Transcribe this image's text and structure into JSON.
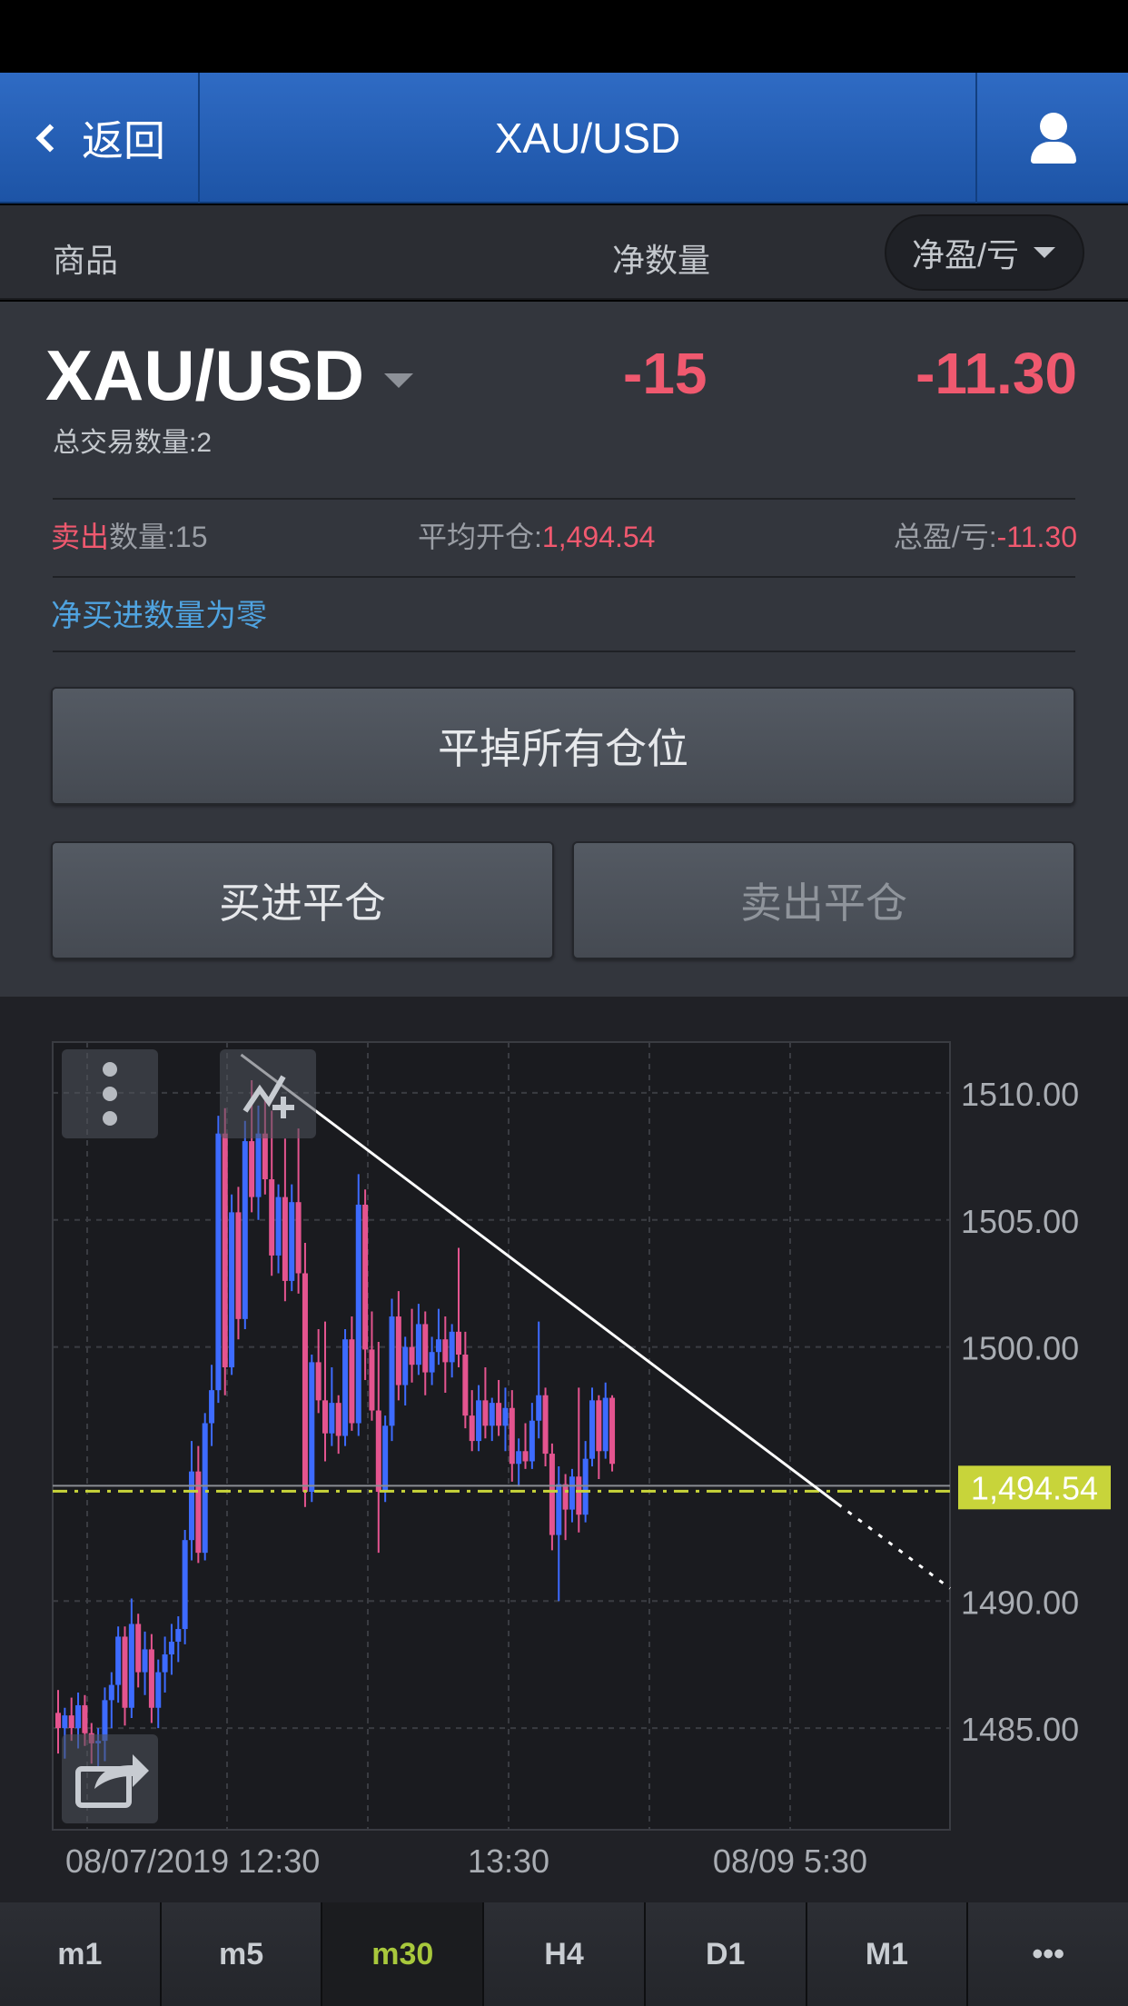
{
  "navbar": {
    "back_label": "返回",
    "title": "XAU/USD"
  },
  "columns": {
    "product": "商品",
    "net_qty": "净数量",
    "pnl_select": "净盈/亏"
  },
  "position": {
    "symbol": "XAU/USD",
    "total_trades": "总交易数量:2",
    "net_qty": "-15",
    "net_pnl": "-11.30",
    "side": "卖出",
    "qty": "数量:15",
    "avg_open_label": "平均开仓:",
    "avg_open_value": "1,494.54",
    "total_pnl_label": "总盈/亏:",
    "total_pnl_value": "-11.30",
    "zero_note": "净买进数量为零"
  },
  "buttons": {
    "close_all": "平掉所有仓位",
    "buy_close": "买进平仓",
    "sell_close": "卖出平仓"
  },
  "chart_data": {
    "type": "candlestick",
    "symbol": "XAU/USD",
    "ylim": [
      1481,
      1512
    ],
    "y_ticks": [
      "1510.00",
      "1505.00",
      "1500.00",
      "1490.00",
      "1485.00"
    ],
    "x_ticks": [
      "08/07/2019 12:30",
      "13:30",
      "08/09 5:30"
    ],
    "current_price_label": "1,494.54",
    "current_price": 1494.54,
    "colors": {
      "up": "#3d6bff",
      "down": "#e4548f",
      "price_line": "#c8d43a",
      "trendline": "#ffffff"
    },
    "trendline": {
      "start": [
        0.21,
        1511.5
      ],
      "end": [
        1.0,
        1490.5
      ]
    },
    "candles": [
      [
        1485.6,
        1486.5,
        1484.0,
        1485.0
      ],
      [
        1485.0,
        1485.8,
        1483.8,
        1485.5
      ],
      [
        1485.5,
        1486.2,
        1484.5,
        1485.0
      ],
      [
        1485.0,
        1486.4,
        1484.2,
        1485.9
      ],
      [
        1485.9,
        1486.3,
        1484.3,
        1484.8
      ],
      [
        1484.8,
        1485.2,
        1483.6,
        1484.4
      ],
      [
        1484.4,
        1485.0,
        1483.5,
        1484.5
      ],
      [
        1484.5,
        1486.6,
        1483.7,
        1486.1
      ],
      [
        1486.1,
        1487.2,
        1485.0,
        1486.7
      ],
      [
        1486.7,
        1489.0,
        1486.0,
        1488.6
      ],
      [
        1488.6,
        1489.0,
        1485.1,
        1485.8
      ],
      [
        1485.8,
        1490.1,
        1485.4,
        1489.1
      ],
      [
        1489.1,
        1489.5,
        1486.6,
        1487.2
      ],
      [
        1487.2,
        1488.8,
        1486.3,
        1488.1
      ],
      [
        1488.1,
        1488.7,
        1485.2,
        1485.8
      ],
      [
        1485.8,
        1487.7,
        1485.0,
        1487.2
      ],
      [
        1487.2,
        1488.6,
        1486.4,
        1487.9
      ],
      [
        1487.9,
        1489.1,
        1487.1,
        1488.4
      ],
      [
        1488.4,
        1489.4,
        1487.6,
        1488.9
      ],
      [
        1488.9,
        1492.8,
        1488.3,
        1492.4
      ],
      [
        1492.4,
        1496.3,
        1491.6,
        1495.1
      ],
      [
        1495.1,
        1496.1,
        1491.5,
        1491.9
      ],
      [
        1491.9,
        1497.4,
        1491.6,
        1497.0
      ],
      [
        1497.0,
        1499.3,
        1496.1,
        1498.3
      ],
      [
        1498.3,
        1509.1,
        1497.8,
        1508.4
      ],
      [
        1508.4,
        1509.4,
        1498.1,
        1499.2
      ],
      [
        1499.2,
        1506.0,
        1498.9,
        1505.3
      ],
      [
        1505.3,
        1506.3,
        1500.3,
        1501.1
      ],
      [
        1501.1,
        1508.9,
        1500.7,
        1508.1
      ],
      [
        1508.1,
        1510.5,
        1505.3,
        1505.9
      ],
      [
        1505.9,
        1509.5,
        1505.0,
        1508.4
      ],
      [
        1508.4,
        1510.0,
        1506.0,
        1506.6
      ],
      [
        1506.6,
        1509.3,
        1502.8,
        1503.6
      ],
      [
        1503.6,
        1506.4,
        1502.9,
        1505.9
      ],
      [
        1505.9,
        1508.2,
        1501.8,
        1502.6
      ],
      [
        1502.6,
        1506.4,
        1502.2,
        1505.7
      ],
      [
        1505.7,
        1508.6,
        1502.1,
        1502.9
      ],
      [
        1502.9,
        1504.1,
        1493.7,
        1494.3
      ],
      [
        1494.3,
        1499.7,
        1493.9,
        1499.4
      ],
      [
        1499.4,
        1500.7,
        1497.4,
        1497.9
      ],
      [
        1497.9,
        1501.0,
        1495.5,
        1496.6
      ],
      [
        1496.6,
        1499.2,
        1496.1,
        1497.8
      ],
      [
        1497.8,
        1498.1,
        1495.8,
        1496.5
      ],
      [
        1496.5,
        1500.7,
        1496.1,
        1500.3
      ],
      [
        1500.3,
        1501.2,
        1496.7,
        1497.0
      ],
      [
        1497.0,
        1506.8,
        1496.5,
        1505.6
      ],
      [
        1505.6,
        1506.2,
        1498.7,
        1499.9
      ],
      [
        1499.9,
        1501.4,
        1497.1,
        1497.5
      ],
      [
        1497.5,
        1500.2,
        1491.9,
        1494.3
      ],
      [
        1494.3,
        1497.3,
        1493.9,
        1496.9
      ],
      [
        1496.9,
        1501.9,
        1496.3,
        1501.2
      ],
      [
        1501.2,
        1502.2,
        1497.9,
        1498.5
      ],
      [
        1498.5,
        1500.4,
        1497.7,
        1500.0
      ],
      [
        1500.0,
        1501.5,
        1498.6,
        1499.3
      ],
      [
        1499.3,
        1501.7,
        1498.9,
        1500.9
      ],
      [
        1500.9,
        1501.4,
        1498.1,
        1499.0
      ],
      [
        1499.0,
        1500.4,
        1498.5,
        1499.8
      ],
      [
        1499.8,
        1501.5,
        1499.3,
        1500.3
      ],
      [
        1500.3,
        1501.2,
        1498.2,
        1499.4
      ],
      [
        1499.4,
        1500.9,
        1498.8,
        1500.6
      ],
      [
        1500.6,
        1503.9,
        1499.2,
        1499.7
      ],
      [
        1499.7,
        1500.6,
        1496.8,
        1497.3
      ],
      [
        1497.3,
        1498.3,
        1495.9,
        1496.3
      ],
      [
        1496.3,
        1498.5,
        1495.9,
        1497.9
      ],
      [
        1497.9,
        1499.2,
        1496.4,
        1496.9
      ],
      [
        1496.9,
        1498.0,
        1496.3,
        1497.8
      ],
      [
        1497.8,
        1498.7,
        1496.5,
        1496.9
      ],
      [
        1496.9,
        1498.4,
        1495.9,
        1497.6
      ],
      [
        1497.6,
        1498.3,
        1494.7,
        1495.4
      ],
      [
        1495.4,
        1496.4,
        1494.5,
        1495.9
      ],
      [
        1495.9,
        1497.0,
        1495.2,
        1495.5
      ],
      [
        1495.5,
        1497.8,
        1495.2,
        1497.1
      ],
      [
        1497.1,
        1501.0,
        1496.4,
        1498.1
      ],
      [
        1498.1,
        1498.4,
        1495.3,
        1495.8
      ],
      [
        1495.8,
        1496.2,
        1492.0,
        1492.6
      ],
      [
        1492.6,
        1495.3,
        1490.0,
        1494.6
      ],
      [
        1494.6,
        1495.0,
        1492.4,
        1493.6
      ],
      [
        1493.6,
        1495.2,
        1493.1,
        1494.9
      ],
      [
        1494.9,
        1498.4,
        1492.7,
        1493.4
      ],
      [
        1493.4,
        1496.3,
        1493.1,
        1495.6
      ],
      [
        1495.6,
        1498.4,
        1495.3,
        1497.9
      ],
      [
        1497.9,
        1498.1,
        1494.8,
        1495.9
      ],
      [
        1495.9,
        1498.6,
        1495.6,
        1498.0
      ],
      [
        1498.0,
        1498.1,
        1495.1,
        1495.4
      ]
    ]
  },
  "timeframes": [
    {
      "label": "m1",
      "active": false
    },
    {
      "label": "m5",
      "active": false
    },
    {
      "label": "m30",
      "active": true
    },
    {
      "label": "H4",
      "active": false
    },
    {
      "label": "D1",
      "active": false
    },
    {
      "label": "M1",
      "active": false
    },
    {
      "label": "•••",
      "active": false
    }
  ]
}
